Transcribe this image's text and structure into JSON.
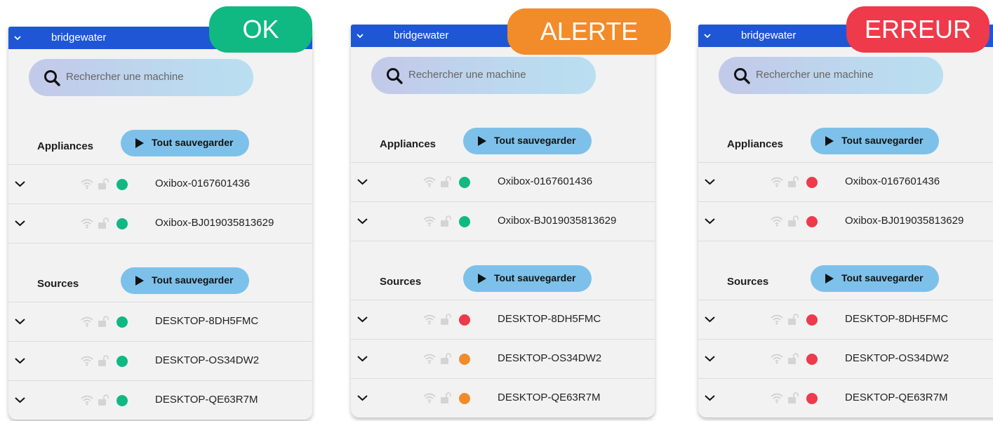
{
  "colors": {
    "ok": "#10b981",
    "alert": "#f28b2a",
    "error": "#ee3a4b",
    "topbar": "#1f56d6",
    "button": "#7dc1ea"
  },
  "panels": [
    {
      "badge": {
        "label": "OK",
        "color": "#10b981"
      },
      "app_title": "bridgewater",
      "search_placeholder": "Rechercher une machine",
      "appliances": {
        "label": "Appliances",
        "button": "Tout sauvegarder",
        "items": [
          {
            "name": "Oxibox-0167601436",
            "status": "ok",
            "status_color": "#10b981"
          },
          {
            "name": "Oxibox-BJ019035813629",
            "status": "ok",
            "status_color": "#10b981"
          }
        ]
      },
      "sources": {
        "label": "Sources",
        "button": "Tout sauvegarder",
        "items": [
          {
            "name": "DESKTOP-8DH5FMC",
            "status": "ok",
            "status_color": "#10b981"
          },
          {
            "name": "DESKTOP-OS34DW2",
            "status": "ok",
            "status_color": "#10b981"
          },
          {
            "name": "DESKTOP-QE63R7M",
            "status": "ok",
            "status_color": "#10b981"
          }
        ]
      }
    },
    {
      "badge": {
        "label": "ALERTE",
        "color": "#f28b2a"
      },
      "app_title": "bridgewater",
      "search_placeholder": "Rechercher une machine",
      "appliances": {
        "label": "Appliances",
        "button": "Tout sauvegarder",
        "items": [
          {
            "name": "Oxibox-0167601436",
            "status": "ok",
            "status_color": "#10b981"
          },
          {
            "name": "Oxibox-BJ019035813629",
            "status": "ok",
            "status_color": "#10b981"
          }
        ]
      },
      "sources": {
        "label": "Sources",
        "button": "Tout sauvegarder",
        "items": [
          {
            "name": "DESKTOP-8DH5FMC",
            "status": "error",
            "status_color": "#ee3a4b"
          },
          {
            "name": "DESKTOP-OS34DW2",
            "status": "alert",
            "status_color": "#f28b2a"
          },
          {
            "name": "DESKTOP-QE63R7M",
            "status": "alert",
            "status_color": "#f28b2a"
          }
        ]
      }
    },
    {
      "badge": {
        "label": "ERREUR",
        "color": "#ee3a4b"
      },
      "app_title": "bridgewater",
      "search_placeholder": "Rechercher une machine",
      "appliances": {
        "label": "Appliances",
        "button": "Tout sauvegarder",
        "items": [
          {
            "name": "Oxibox-0167601436",
            "status": "error",
            "status_color": "#ee3a4b"
          },
          {
            "name": "Oxibox-BJ019035813629",
            "status": "error",
            "status_color": "#ee3a4b"
          }
        ]
      },
      "sources": {
        "label": "Sources",
        "button": "Tout sauvegarder",
        "items": [
          {
            "name": "DESKTOP-8DH5FMC",
            "status": "error",
            "status_color": "#ee3a4b"
          },
          {
            "name": "DESKTOP-OS34DW2",
            "status": "error",
            "status_color": "#ee3a4b"
          },
          {
            "name": "DESKTOP-QE63R7M",
            "status": "error",
            "status_color": "#ee3a4b"
          }
        ]
      }
    }
  ],
  "icons": {
    "collapse": "chevron-down-icon",
    "search": "search-icon",
    "play": "play-icon",
    "wifi": "wifi-icon",
    "lock": "unlock-icon",
    "status": "status-dot-icon"
  }
}
